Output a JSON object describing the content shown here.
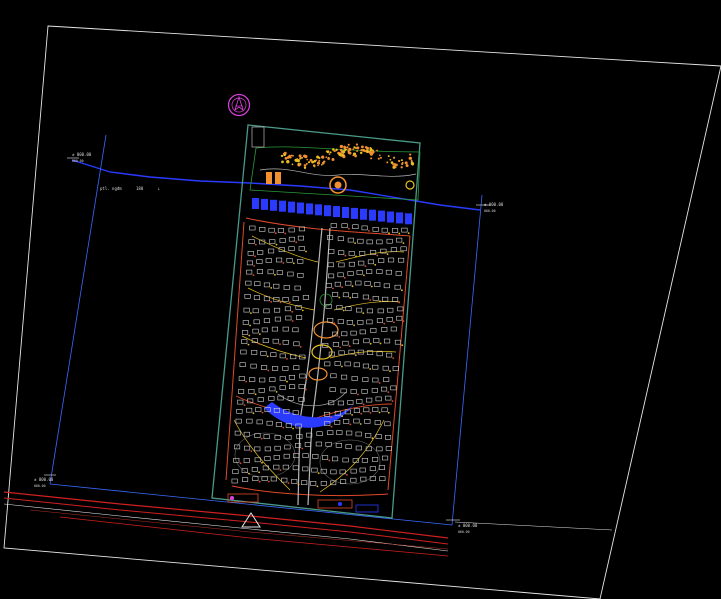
{
  "drawing": {
    "background": "#000000",
    "colors": {
      "frame": "#e6e6e6",
      "boundary": "#4a9a8a",
      "road_inner": "#b8b8b8",
      "road_outer": "#e04a2a",
      "path_yellow": "#e8c020",
      "water": "#2a3aff",
      "dim_line": "#3a6aff",
      "highway": "#d02020",
      "landscape": "#f09030",
      "green": "#2a9a3a",
      "north": "#e040e0",
      "house": "#d0d0d0"
    },
    "icons": {
      "north_arrow": "north-arrow-icon",
      "entrance_marker": "triangle-marker-icon"
    },
    "labels": {
      "elev_top_left": "± 000.00",
      "elev_top_left_sub": "000.00",
      "road_note": "ptl. ngđm",
      "road_note_num": "180",
      "road_note_suffix": "L",
      "elev_right": "± 000.00",
      "elev_right_sub": "000.00",
      "elev_bottom_left": "± 000.00",
      "elev_bottom_left_sub": "000.00",
      "elev_bottom_right": "± 000.00",
      "elev_bottom_right_sub": "000.00"
    }
  }
}
